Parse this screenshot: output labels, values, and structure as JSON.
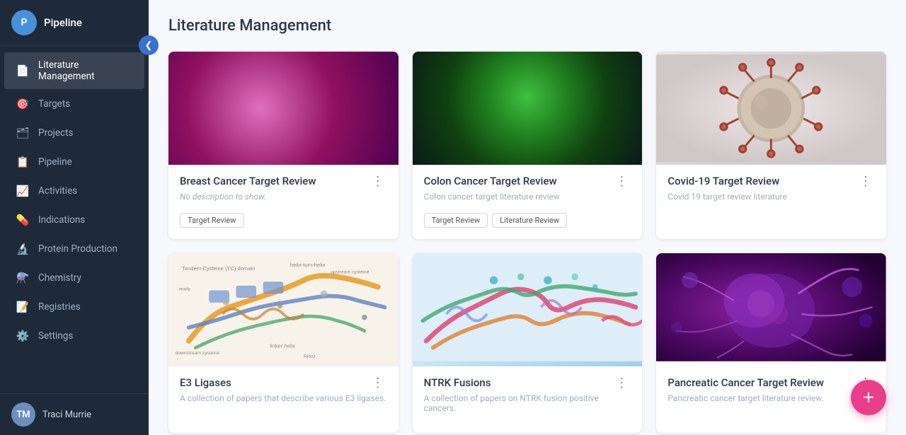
{
  "app": {
    "name": "Pipeline",
    "avatar_initials": "P"
  },
  "sidebar": {
    "collapse_icon": "❮",
    "items": [
      {
        "id": "literature",
        "label": "Literature Management",
        "icon": "📄",
        "active": true
      },
      {
        "id": "targets",
        "label": "Targets",
        "icon": "🎯",
        "active": false
      },
      {
        "id": "projects",
        "label": "Projects",
        "icon": "🗂",
        "active": false
      },
      {
        "id": "pipeline",
        "label": "Pipeline",
        "icon": "📋",
        "active": false
      },
      {
        "id": "activities",
        "label": "Activities",
        "icon": "📈",
        "active": false
      },
      {
        "id": "indications",
        "label": "Indications",
        "icon": "💊",
        "active": false
      },
      {
        "id": "protein",
        "label": "Protein Production",
        "icon": "🔬",
        "active": false
      },
      {
        "id": "chemistry",
        "label": "Chemistry",
        "icon": "⚗️",
        "active": false
      },
      {
        "id": "registries",
        "label": "Registries",
        "icon": "📝",
        "active": false
      },
      {
        "id": "settings",
        "label": "Settings",
        "icon": "⚙️",
        "active": false
      }
    ]
  },
  "user": {
    "name": "Traci Murrie",
    "initials": "TM"
  },
  "page": {
    "title": "Literature Management"
  },
  "cards": [
    {
      "id": "breast-cancer",
      "title": "Breast Cancer Target Review",
      "description": "No description to show.",
      "description_italic": true,
      "tags": [
        "Target Review"
      ],
      "img_type": "breast"
    },
    {
      "id": "colon-cancer",
      "title": "Colon Cancer Target Review",
      "description": "Colon cancer target literature review",
      "description_italic": false,
      "tags": [
        "Target Review",
        "Literature Review"
      ],
      "img_type": "colon"
    },
    {
      "id": "covid-19",
      "title": "Covid-19 Target Review",
      "description": "Covid 19 target review literature",
      "description_italic": false,
      "tags": [],
      "img_type": "covid"
    },
    {
      "id": "e3-ligases",
      "title": "E3 Ligases",
      "description": "A collection of papers that describe various E3 ligases.",
      "description_italic": false,
      "tags": [],
      "img_type": "e3"
    },
    {
      "id": "ntrk-fusions",
      "title": "NTRK Fusions",
      "description": "A collection of papers on NTRK fusion positive cancers.",
      "description_italic": false,
      "tags": [],
      "img_type": "ntrk"
    },
    {
      "id": "pancreatic-cancer",
      "title": "Pancreatic Cancer Target Review",
      "description": "Pancreatic cancer target literature review.",
      "description_italic": false,
      "tags": [],
      "img_type": "pancreatic"
    }
  ],
  "fab": {
    "icon": "+",
    "label": "Add new"
  },
  "colors": {
    "sidebar_bg": "#1e2a3a",
    "active_nav": "rgba(255,255,255,0.12)",
    "fab_bg": "#e83e8c",
    "collapse_btn": "#3b6fd4"
  }
}
